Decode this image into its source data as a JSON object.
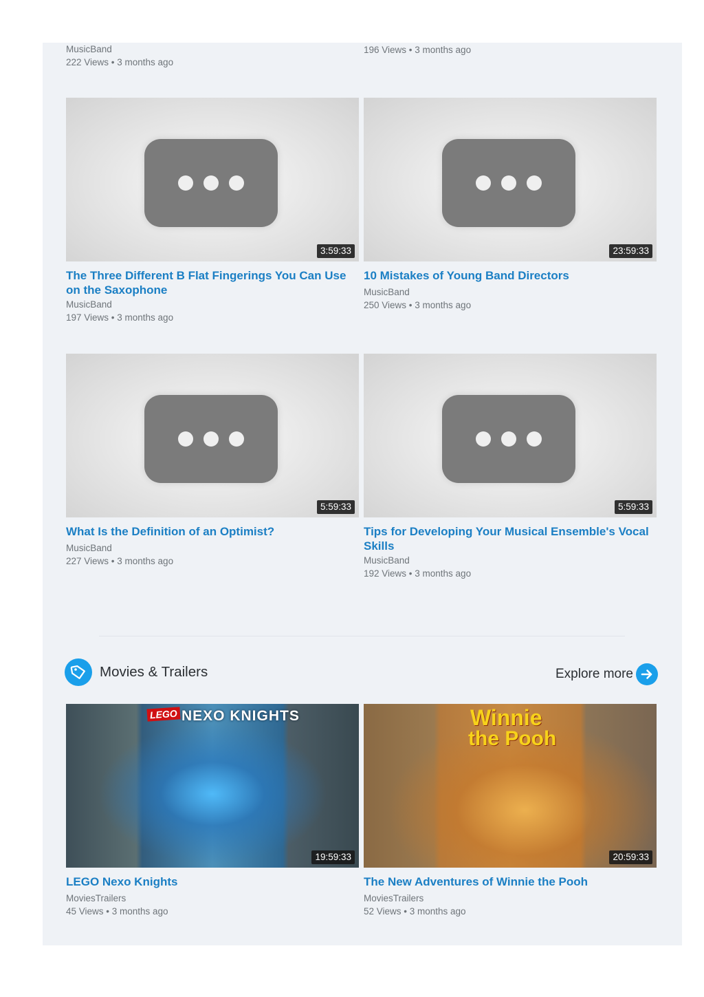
{
  "top_row": [
    {
      "channel": "MusicBand",
      "meta": "222 Views • 3 months ago"
    },
    {
      "channel": "",
      "meta": "196 Views • 3 months ago"
    }
  ],
  "music_videos": [
    {
      "duration": "3:59:33",
      "title": "The Three Different B Flat Fingerings You Can Use on the Saxophone",
      "channel": "MusicBand",
      "meta": "197 Views • 3 months ago"
    },
    {
      "duration": "23:59:33",
      "title": "10 Mistakes of Young Band Directors",
      "channel": "MusicBand",
      "meta": "250 Views • 3 months ago"
    },
    {
      "duration": "5:59:33",
      "title": "What Is the Definition of an Optimist?",
      "channel": "MusicBand",
      "meta": "227 Views • 3 months ago"
    },
    {
      "duration": "5:59:33",
      "title": "Tips for Developing Your Musical Ensemble's Vocal Skills",
      "channel": "MusicBand",
      "meta": "192 Views • 3 months ago"
    }
  ],
  "category": {
    "title": "Movies & Trailers",
    "explore_label": "Explore more",
    "icon": "tag-icon",
    "explore_icon": "arrow-right-icon",
    "accent": "#1a9fea"
  },
  "movies": [
    {
      "duration": "19:59:33",
      "title": "LEGO Nexo Knights",
      "channel": "MoviesTrailers",
      "meta": "45 Views • 3 months ago",
      "poster_brand": "LEGO",
      "poster_title": "NEXO KNIGHTS"
    },
    {
      "duration": "20:59:33",
      "title": "The New Adventures of Winnie the Pooh",
      "channel": "MoviesTrailers",
      "meta": "52 Views • 3 months ago",
      "poster_line1": "Winnie",
      "poster_line2": "the Pooh"
    }
  ],
  "colors": {
    "link": "#1b7fc4",
    "panel": "#eff2f6",
    "muted": "#6e7479"
  }
}
